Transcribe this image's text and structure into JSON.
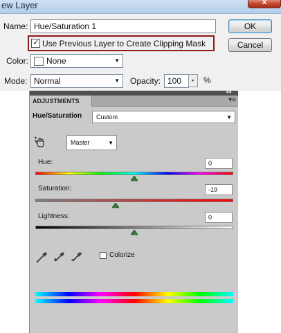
{
  "dialog": {
    "title": "ew Layer",
    "close_label": "x",
    "name_label": "Name:",
    "name_value": "Hue/Saturation 1",
    "ok_label": "OK",
    "cancel_label": "Cancel",
    "clip_checked": true,
    "clip_label": "Use Previous Layer to Create Clipping Mask",
    "color_label": "Color:",
    "color_value": "None",
    "mode_label": "Mode:",
    "mode_value": "Normal",
    "opacity_label": "Opacity:",
    "opacity_value": "100",
    "opacity_unit": "%"
  },
  "panel": {
    "tab": "ADJUSTMENTS",
    "adjustment_label": "Hue/Saturation",
    "preset_value": "Custom",
    "channel_value": "Master",
    "hue_label": "Hue:",
    "hue_value": 0,
    "saturation_label": "Saturation:",
    "saturation_value": -19,
    "lightness_label": "Lightness:",
    "lightness_value": 0,
    "colorize_label": "Colorize",
    "colorize_checked": false
  },
  "icons": {
    "close": "close-icon",
    "dropdown": "chevron-down-icon",
    "panel_menu": "panel-menu-icon",
    "hand_tool": "targeted-adjustment-hand-icon",
    "eyedropper": "eyedropper-icon",
    "eyedropper_plus": "eyedropper-plus-icon",
    "eyedropper_minus": "eyedropper-minus-icon",
    "slider_thumb": "slider-thumb-icon"
  },
  "colors": {
    "clip_highlight": "#8b1a1a",
    "panel_background": "#cacaca",
    "slider_thumb": "#2e7d2e"
  }
}
